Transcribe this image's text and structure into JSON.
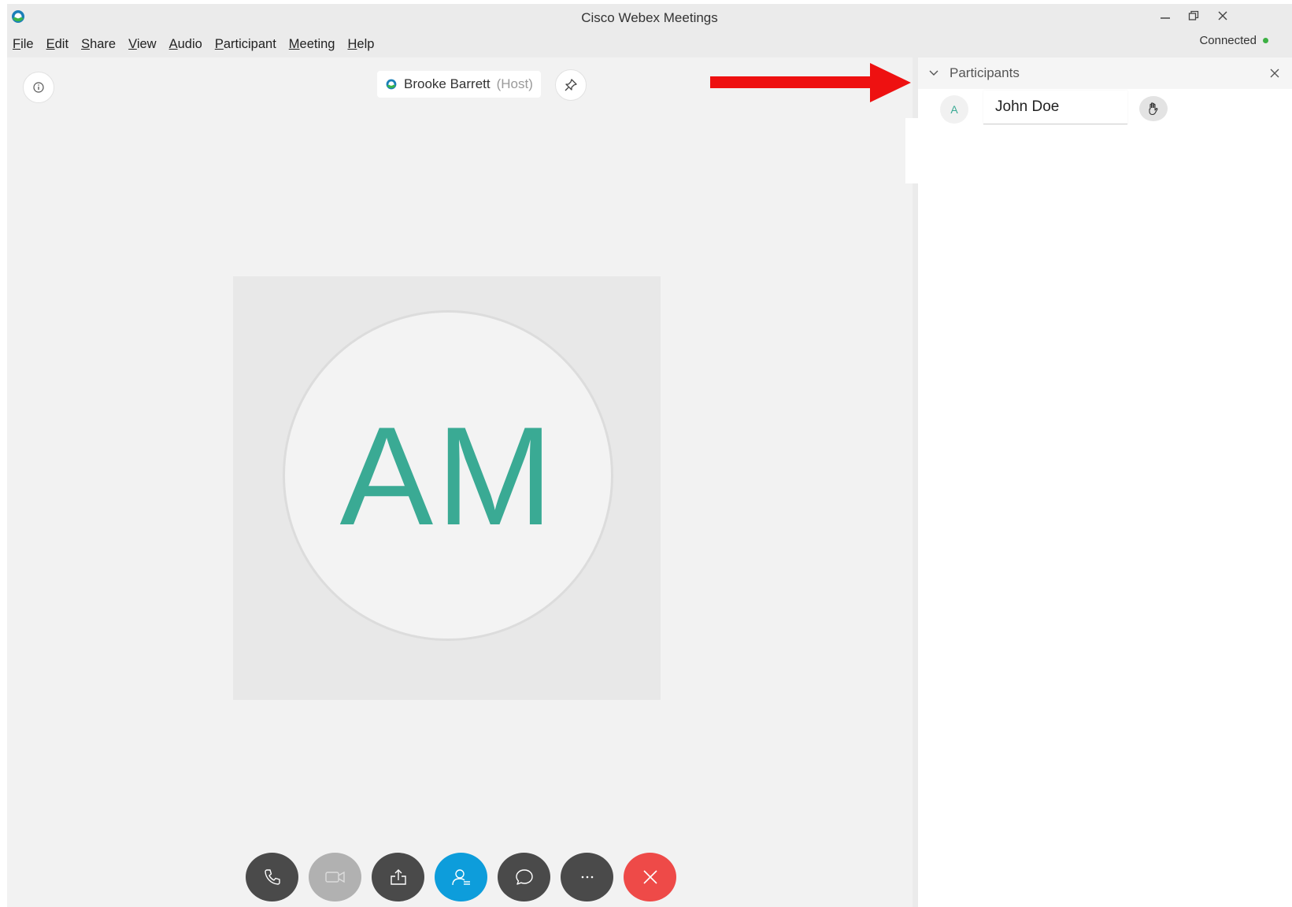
{
  "window": {
    "title": "Cisco Webex Meetings",
    "status": "Connected",
    "status_color": "#3cb043",
    "controls": [
      "minimize-icon",
      "restore-icon",
      "close-icon"
    ]
  },
  "menu": [
    {
      "underline": "F",
      "rest": "ile"
    },
    {
      "underline": "E",
      "rest": "dit"
    },
    {
      "underline": "S",
      "rest": "hare"
    },
    {
      "underline": "V",
      "rest": "iew"
    },
    {
      "underline": "A",
      "rest": "udio"
    },
    {
      "underline": "P",
      "rest": "articipant"
    },
    {
      "underline": "M",
      "rest": "eeting"
    },
    {
      "underline": "H",
      "rest": "elp"
    }
  ],
  "stage": {
    "host_name": "Brooke Barrett",
    "host_tag": "(Host)",
    "active_initials": "AM",
    "initials_color": "#3aaa94"
  },
  "controls": [
    {
      "icon": "phone-icon",
      "style": "dark"
    },
    {
      "icon": "video-off-icon",
      "style": "grey"
    },
    {
      "icon": "share-icon",
      "style": "dark"
    },
    {
      "icon": "participants-icon",
      "style": "blue"
    },
    {
      "icon": "chat-icon",
      "style": "dark"
    },
    {
      "icon": "more-icon",
      "style": "dark"
    },
    {
      "icon": "end-call-icon",
      "style": "red"
    }
  ],
  "panel": {
    "title": "Participants",
    "participants": [
      {
        "initial": "A",
        "name": "John Doe"
      }
    ]
  },
  "colors": {
    "accent_blue": "#0d9ddb",
    "end_red": "#ee4a48",
    "arrow_red": "#ee1111"
  }
}
